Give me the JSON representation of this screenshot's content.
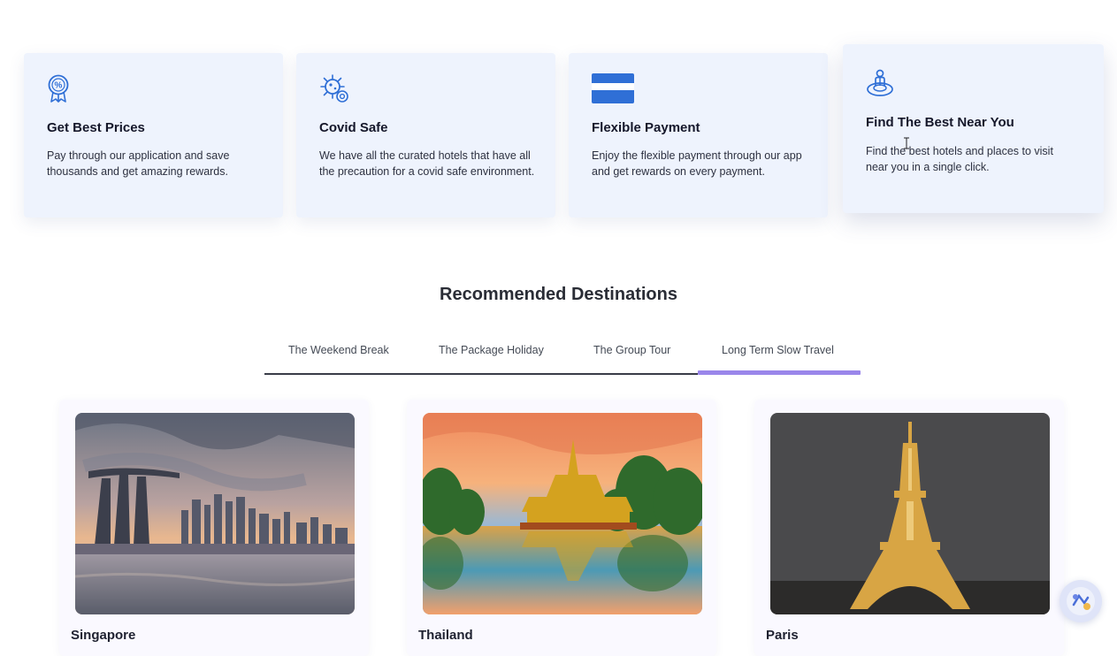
{
  "services": [
    {
      "icon": "badge-percent-icon",
      "title": "Get Best Prices",
      "desc": "Pay through our application and save thousands and get amazing rewards."
    },
    {
      "icon": "virus-shield-icon",
      "title": "Covid Safe",
      "desc": "We have all the curated hotels that have all the precaution for a covid safe environment."
    },
    {
      "icon": "credit-card-icon",
      "title": "Flexible Payment",
      "desc": "Enjoy the flexible payment through our app and get rewards on every payment."
    },
    {
      "icon": "location-person-icon",
      "title": "Find The Best Near You",
      "desc": "Find the best hotels and places to visit near you in a single click."
    }
  ],
  "recommended": {
    "title": "Recommended Destinations",
    "tabs": [
      "The Weekend Break",
      "The Package Holiday",
      "The Group Tour",
      "Long Term Slow Travel"
    ],
    "active_tab": 3
  },
  "destinations": [
    {
      "name": "Singapore",
      "image": "singapore-skyline-photo"
    },
    {
      "name": "Thailand",
      "image": "thailand-pagoda-photo"
    },
    {
      "name": "Paris",
      "image": "eiffel-tower-night-photo"
    }
  ],
  "colors": {
    "accent": "#9a86ea",
    "icon_blue": "#2f6fd6",
    "card_bg": "#eef3fd"
  }
}
